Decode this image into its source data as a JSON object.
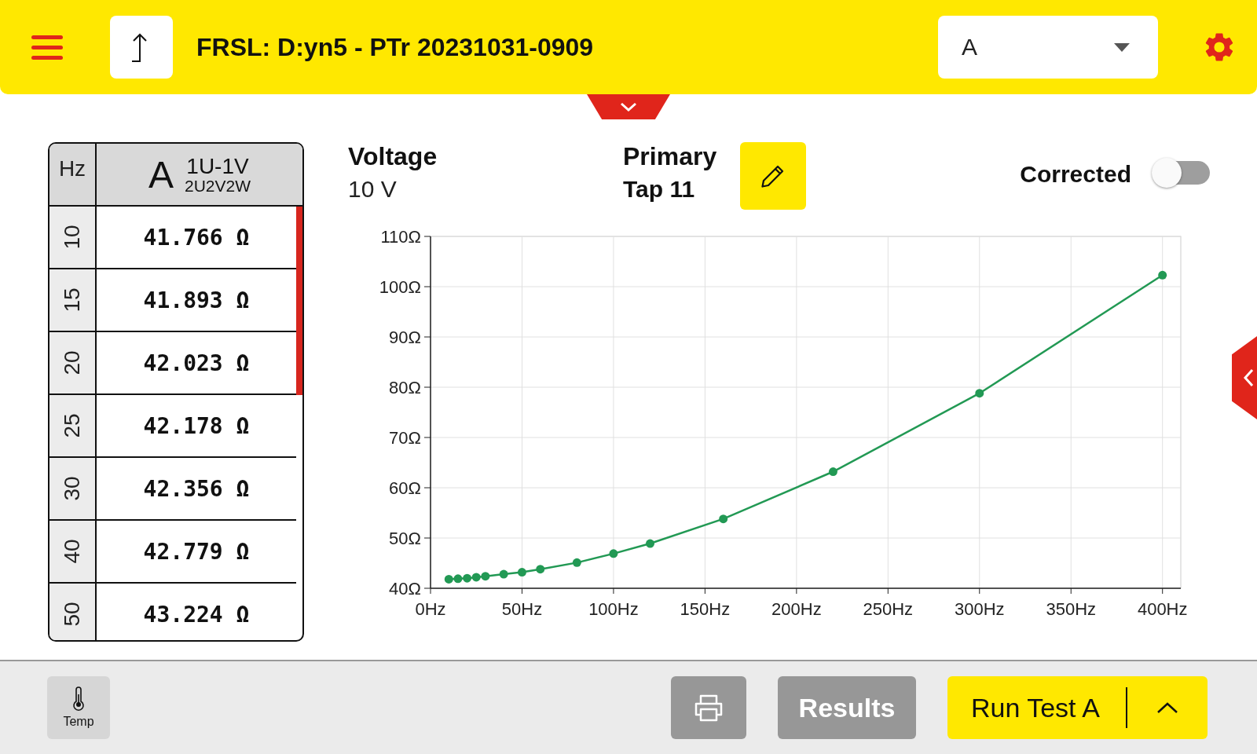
{
  "header": {
    "title": "FRSL: D:yn5 - PTr 20231031-0909",
    "dropdown": {
      "value": "A"
    }
  },
  "table": {
    "columns": [
      {
        "label": "Hz"
      },
      {
        "label": "A",
        "top": "1U-1V",
        "bottom": "2U2V2W"
      }
    ],
    "rows": [
      {
        "hz": "10",
        "value": "41.766 Ω"
      },
      {
        "hz": "15",
        "value": "41.893 Ω"
      },
      {
        "hz": "20",
        "value": "42.023 Ω"
      },
      {
        "hz": "25",
        "value": "42.178 Ω"
      },
      {
        "hz": "30",
        "value": "42.356 Ω"
      },
      {
        "hz": "40",
        "value": "42.779 Ω"
      },
      {
        "hz": "50",
        "value": "43.224 Ω"
      }
    ]
  },
  "info": {
    "voltage_label": "Voltage",
    "voltage_value": "10 V",
    "winding_label": "Primary",
    "tap": "Tap 11",
    "corrected": {
      "label": "Corrected",
      "on": false
    }
  },
  "chart_data": {
    "type": "line",
    "x": [
      10,
      15,
      20,
      25,
      30,
      40,
      50,
      60,
      80,
      100,
      120,
      160,
      220,
      300,
      400
    ],
    "series": [
      {
        "color": "#229954",
        "marker": "circle",
        "values": [
          41.8,
          41.9,
          42.0,
          42.2,
          42.4,
          42.8,
          43.2,
          43.8,
          45.1,
          46.9,
          48.9,
          53.8,
          63.2,
          78.8,
          102.3
        ]
      }
    ],
    "grid": true,
    "xlim": [
      0,
      410
    ],
    "ylim": [
      40,
      110
    ],
    "xticks": [
      {
        "value": 0,
        "label": "0Hz"
      },
      {
        "value": 50,
        "label": "50Hz"
      },
      {
        "value": 100,
        "label": "100Hz"
      },
      {
        "value": 150,
        "label": "150Hz"
      },
      {
        "value": 200,
        "label": "200Hz"
      },
      {
        "value": 250,
        "label": "250Hz"
      },
      {
        "value": 300,
        "label": "300Hz"
      },
      {
        "value": 350,
        "label": "350Hz"
      },
      {
        "value": 400,
        "label": "400Hz"
      }
    ],
    "yticks": [
      {
        "value": 40,
        "label": "40Ω"
      },
      {
        "value": 50,
        "label": "50Ω"
      },
      {
        "value": 60,
        "label": "60Ω"
      },
      {
        "value": 70,
        "label": "70Ω"
      },
      {
        "value": 80,
        "label": "80Ω"
      },
      {
        "value": 90,
        "label": "90Ω"
      },
      {
        "value": 100,
        "label": "100Ω"
      },
      {
        "value": 110,
        "label": "110Ω"
      }
    ]
  },
  "footer": {
    "temp_label": "Temp",
    "results_label": "Results",
    "run_label": "Run Test A"
  }
}
